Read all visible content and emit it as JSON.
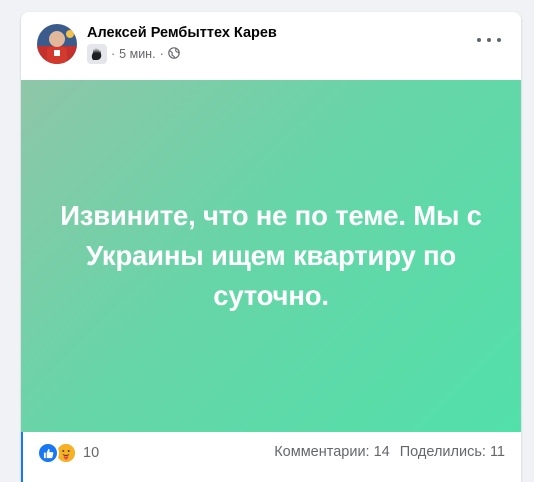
{
  "post": {
    "author": "Алексей Рембыттех Карев",
    "time": "5 мин.",
    "separator": "·",
    "text": "Извините, что не по теме. Мы с Украины ищем квартиру по суточно.",
    "background_colors": [
      "#8ec6a8",
      "#52e0aa"
    ]
  },
  "icons": {
    "group": "hand-badge-icon",
    "audience": "globe-icon",
    "more": "more-options-icon",
    "like": "like-reaction-icon",
    "care": "care-reaction-icon"
  },
  "footer": {
    "reaction_count": "10",
    "comments": "Комментарии: 14",
    "shares": "Поделились: 11"
  },
  "colors": {
    "accent": "#1877f2",
    "secondary_text": "#65676b"
  }
}
